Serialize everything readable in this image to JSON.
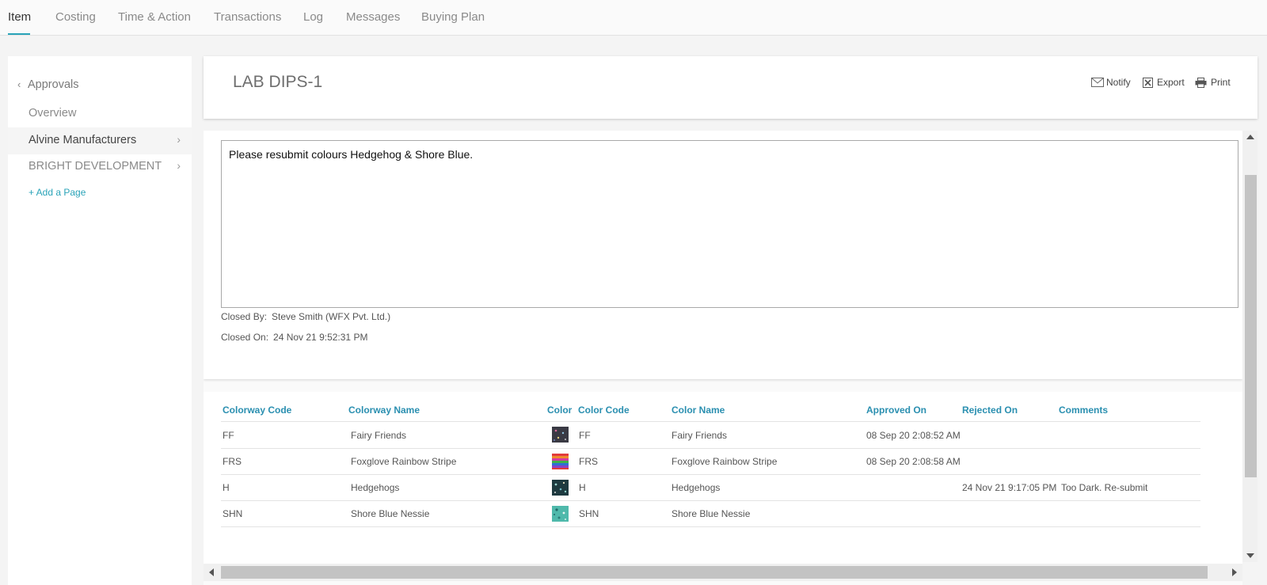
{
  "tabs": [
    {
      "label": "Item",
      "active": true
    },
    {
      "label": "Costing"
    },
    {
      "label": "Time & Action"
    },
    {
      "label": "Transactions"
    },
    {
      "label": "Log"
    },
    {
      "label": "Messages"
    },
    {
      "label": "Buying Plan"
    }
  ],
  "sidebar": {
    "back_label": "Approvals",
    "items": [
      {
        "label": "Overview",
        "has_arrow": false,
        "active": false
      },
      {
        "label": "Alvine Manufacturers",
        "has_arrow": true,
        "active": true
      },
      {
        "label": "BRIGHT DEVELOPMENT",
        "has_arrow": true,
        "active": false
      }
    ],
    "add_page": "+ Add a Page"
  },
  "header": {
    "title": "LAB DIPS-1",
    "actions": {
      "notify": "Notify",
      "export": "Export",
      "print": "Print"
    }
  },
  "comment": {
    "text": "Please resubmit colours Hedgehog & Shore Blue.",
    "closed_by_label": "Closed By:",
    "closed_by": "Steve Smith (WFX Pvt. Ltd.)",
    "closed_on_label": "Closed On:",
    "closed_on": "24 Nov 21 9:52:31 PM"
  },
  "table": {
    "headers": {
      "colorway_code": "Colorway Code",
      "colorway_name": "Colorway Name",
      "color": "Color",
      "color_code": "Color Code",
      "color_name": "Color Name",
      "approved_on": "Approved On",
      "rejected_on": "Rejected On",
      "comments": "Comments"
    },
    "rows": [
      {
        "colorway_code": "FF",
        "colorway_name": "Fairy Friends",
        "swatch": "dark-grey-pattern",
        "color_code": "FF",
        "color_name": "Fairy Friends",
        "approved_on": "08 Sep 20 2:08:52 AM",
        "rejected_on": "",
        "comments": ""
      },
      {
        "colorway_code": "FRS",
        "colorway_name": "Foxglove Rainbow Stripe",
        "swatch": "rainbow-stripe",
        "color_code": "FRS",
        "color_name": "Foxglove Rainbow Stripe",
        "approved_on": "08 Sep 20 2:08:58 AM",
        "rejected_on": "",
        "comments": ""
      },
      {
        "colorway_code": "H",
        "colorway_name": "Hedgehogs",
        "swatch": "dark-teal-pattern",
        "color_code": "H",
        "color_name": "Hedgehogs",
        "approved_on": "",
        "rejected_on": "24 Nov 21 9:17:05 PM",
        "comments": "Too Dark. Re-submit"
      },
      {
        "colorway_code": "SHN",
        "colorway_name": "Shore Blue Nessie",
        "swatch": "turquoise-pattern",
        "color_code": "SHN",
        "color_name": "Shore Blue Nessie",
        "approved_on": "",
        "rejected_on": "",
        "comments": ""
      }
    ]
  },
  "colors": {
    "accent": "#29a3b8",
    "header_text": "#2a8fb0"
  }
}
